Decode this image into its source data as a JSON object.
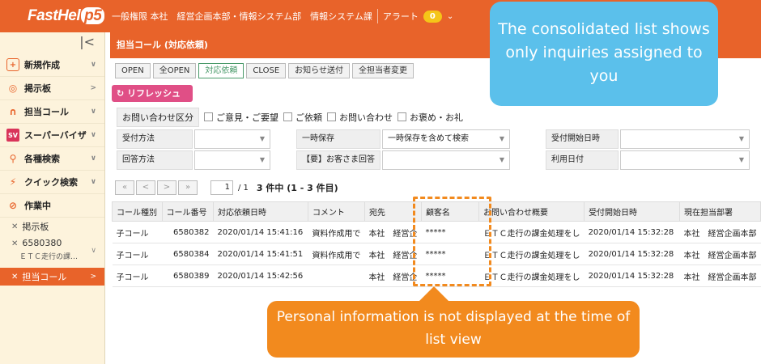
{
  "app": {
    "logo": "FastHelp5"
  },
  "header": {
    "breadcrumb": "一般権限 本社　経営企画本部・情報システム部　情報システム課",
    "alert_label": "アラート",
    "alert_count": "0"
  },
  "sidebar": {
    "collapse": "|<",
    "items": [
      {
        "label": "新規作成"
      },
      {
        "label": "掲示板"
      },
      {
        "label": "担当コール"
      },
      {
        "label": "スーパーバイザ"
      },
      {
        "label": "各種検索"
      },
      {
        "label": "クイック検索"
      },
      {
        "label": "作業中"
      }
    ],
    "working": [
      {
        "label": "掲示板"
      },
      {
        "label": "6580380",
        "sub": "ＥＴＣ走行の課…"
      },
      {
        "label": "担当コール"
      }
    ]
  },
  "page": {
    "title": "担当コール (対応依頼)"
  },
  "tabs": [
    "OPEN",
    "全OPEN",
    "対応依頼",
    "CLOSE",
    "お知らせ送付",
    "全担当者変更"
  ],
  "refresh_label": "リフレッシュ",
  "inquiry": {
    "label": "お問い合わせ区分",
    "options": [
      "ご意見・ご要望",
      "ご依頼",
      "お問い合わせ",
      "お褒め・お礼"
    ]
  },
  "filters": {
    "reception_method": "受付方法",
    "temp_save": "一時保存",
    "temp_save_value": "一時保存を含めて検索",
    "reception_start": "受付開始日時",
    "answer_method": "回答方法",
    "customer_answer": "【要】お客さま回答",
    "use_date": "利用日付"
  },
  "pager": {
    "first": "«",
    "prev": "<",
    "next": ">",
    "last": "»",
    "page": "1",
    "total": "/ 1",
    "count": "3 件中 (1 - 3 件目)"
  },
  "table": {
    "headers": [
      "コール種別",
      "コール番号",
      "対応依頼日時",
      "コメント",
      "宛先",
      "顧客名",
      "お問い合わせ概要",
      "受付開始日時",
      "現在担当部署"
    ],
    "rows": [
      [
        "子コール",
        "6580382",
        "2020/01/14 15:41:16",
        "資料作成用で",
        "本社　経営企",
        "*****",
        "ＥＴＣ走行の課金処理をし",
        "2020/01/14 15:32:28",
        "本社　経営企画本部"
      ],
      [
        "子コール",
        "6580384",
        "2020/01/14 15:41:51",
        "資料作成用で",
        "本社　経営企",
        "*****",
        "ＥＴＣ走行の課金処理をし",
        "2020/01/14 15:32:28",
        "本社　経営企画本部"
      ],
      [
        "子コール",
        "6580389",
        "2020/01/14 15:42:56",
        "",
        "本社　経営企",
        "*****",
        "ＥＴＣ走行の課金処理をし",
        "2020/01/14 15:32:28",
        "本社　経営企画本部"
      ]
    ]
  },
  "callouts": {
    "blue": "The consolidated list shows only inquiries assigned to you",
    "orange": "Personal information is not displayed at the time of list view"
  }
}
